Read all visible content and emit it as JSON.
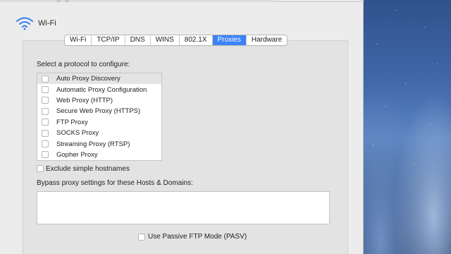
{
  "header": {
    "title": "Wi-Fi",
    "icon": "wifi-icon"
  },
  "tabs": [
    {
      "label": "Wi-Fi",
      "active": false
    },
    {
      "label": "TCP/IP",
      "active": false
    },
    {
      "label": "DNS",
      "active": false
    },
    {
      "label": "WINS",
      "active": false
    },
    {
      "label": "802.1X",
      "active": false
    },
    {
      "label": "Proxies",
      "active": true
    },
    {
      "label": "Hardware",
      "active": false
    }
  ],
  "proxies": {
    "select_label": "Select a protocol to configure:",
    "protocols": [
      {
        "label": "Auto Proxy Discovery",
        "checked": false,
        "selected": true
      },
      {
        "label": "Automatic Proxy Configuration",
        "checked": false,
        "selected": false
      },
      {
        "label": "Web Proxy (HTTP)",
        "checked": false,
        "selected": false
      },
      {
        "label": "Secure Web Proxy (HTTPS)",
        "checked": false,
        "selected": false
      },
      {
        "label": "FTP Proxy",
        "checked": false,
        "selected": false
      },
      {
        "label": "SOCKS Proxy",
        "checked": false,
        "selected": false
      },
      {
        "label": "Streaming Proxy (RTSP)",
        "checked": false,
        "selected": false
      },
      {
        "label": "Gopher Proxy",
        "checked": false,
        "selected": false
      }
    ],
    "exclude_simple_hostnames": {
      "label": "Exclude simple hostnames",
      "checked": false
    },
    "bypass_label": "Bypass proxy settings for these Hosts & Domains:",
    "bypass_value": "",
    "passive_ftp": {
      "label": "Use Passive FTP Mode (PASV)",
      "checked": false
    }
  },
  "colors": {
    "accent": "#3b82f7",
    "window_bg": "#ececec",
    "panel_bg": "#e3e3e3"
  }
}
